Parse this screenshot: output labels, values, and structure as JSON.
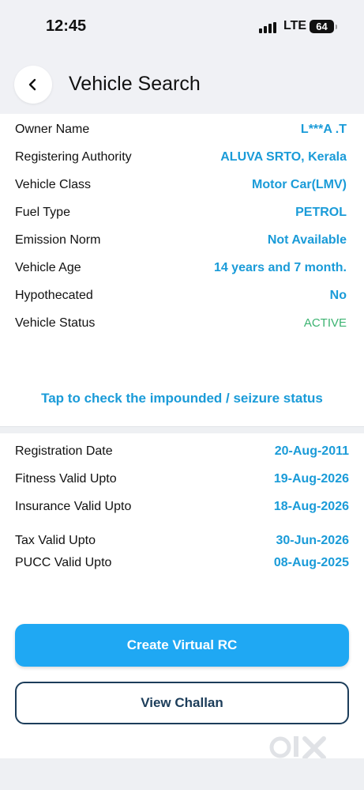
{
  "status_bar": {
    "time": "12:45",
    "network": "LTE",
    "battery": "64"
  },
  "header": {
    "title": "Vehicle Search"
  },
  "vehicle": [
    {
      "label": "Owner Name",
      "value": "L***A .T"
    },
    {
      "label": "Registering Authority",
      "value": "ALUVA SRTO, Kerala"
    },
    {
      "label": "Vehicle Class",
      "value": "Motor Car(LMV)"
    },
    {
      "label": "Fuel Type",
      "value": "PETROL"
    },
    {
      "label": "Emission Norm",
      "value": "Not Available"
    },
    {
      "label": "Vehicle Age",
      "value": "14 years and 7 month."
    },
    {
      "label": "Hypothecated",
      "value": "No"
    },
    {
      "label": "Vehicle Status",
      "value": "ACTIVE"
    }
  ],
  "impound_link": "Tap to check the impounded / seizure status",
  "validity": [
    {
      "label": "Registration Date",
      "value": "20-Aug-2011"
    },
    {
      "label": "Fitness Valid Upto",
      "value": "19-Aug-2026"
    },
    {
      "label": "Insurance Valid Upto",
      "value": "18-Aug-2026"
    },
    {
      "label": "Tax Valid Upto",
      "value": "30-Jun-2026"
    },
    {
      "label": "PUCC Valid Upto",
      "value": "08-Aug-2025"
    }
  ],
  "buttons": {
    "create_rc": "Create Virtual RC",
    "view_challan": "View Challan"
  },
  "colors": {
    "accent": "#1a9bd8",
    "button": "#1fa8f3",
    "status_active": "#3cb371",
    "outline": "#1c3d5a"
  },
  "icons": [
    "chevron-left-icon",
    "signal-icon",
    "battery-icon"
  ]
}
